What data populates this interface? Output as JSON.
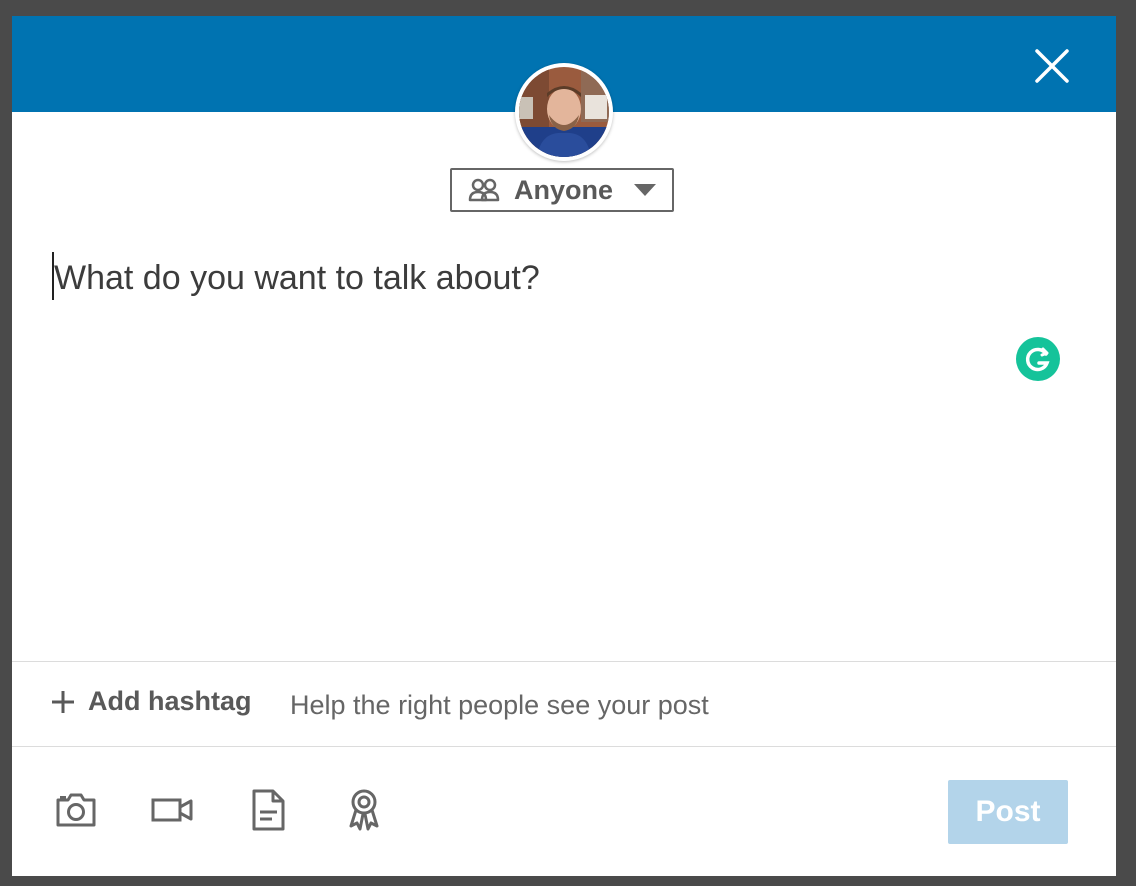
{
  "colors": {
    "header_blue": "#0073b1",
    "post_button_disabled": "#b3d4ea",
    "grammarly_green": "#15c39a",
    "icon_gray": "#666666"
  },
  "header": {
    "close_icon": "close-icon"
  },
  "visibility": {
    "label": "Anyone",
    "icon": "people-icon",
    "caret": "caret-down-icon"
  },
  "composer": {
    "placeholder": "What do you want to talk about?"
  },
  "hashtag": {
    "add_label": "Add hashtag",
    "hint": "Help the right people see your post"
  },
  "toolbar": {
    "tools": [
      "camera-icon",
      "video-icon",
      "document-icon",
      "award-icon"
    ],
    "post_label": "Post"
  }
}
